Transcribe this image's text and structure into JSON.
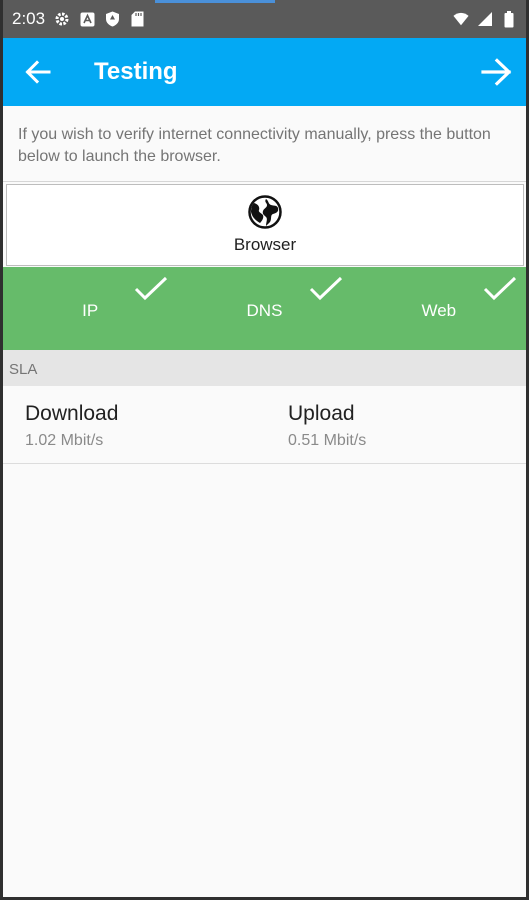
{
  "status_bar": {
    "time": "2:03",
    "icons": [
      "gear-icon",
      "translate-icon",
      "shield-icon",
      "sd-card-icon",
      "wifi-icon",
      "signal-icon",
      "battery-icon"
    ]
  },
  "app_bar": {
    "title": "Testing",
    "back_icon": "arrow-left-icon",
    "next_icon": "arrow-right-icon",
    "background": "#03a9f4"
  },
  "info": {
    "text": "If you wish to verify internet connectivity manually, press the button below to launch the browser."
  },
  "browser_button": {
    "label": "Browser",
    "icon": "globe-icon"
  },
  "checks": {
    "background": "#66bb6a",
    "items": [
      {
        "label": "IP",
        "status_icon": "check-icon"
      },
      {
        "label": "DNS",
        "status_icon": "check-icon"
      },
      {
        "label": "Web",
        "status_icon": "check-icon"
      }
    ]
  },
  "sla": {
    "header": "SLA",
    "download": {
      "label": "Download",
      "value": "1.02 Mbit/s"
    },
    "upload": {
      "label": "Upload",
      "value": "0.51 Mbit/s"
    }
  }
}
